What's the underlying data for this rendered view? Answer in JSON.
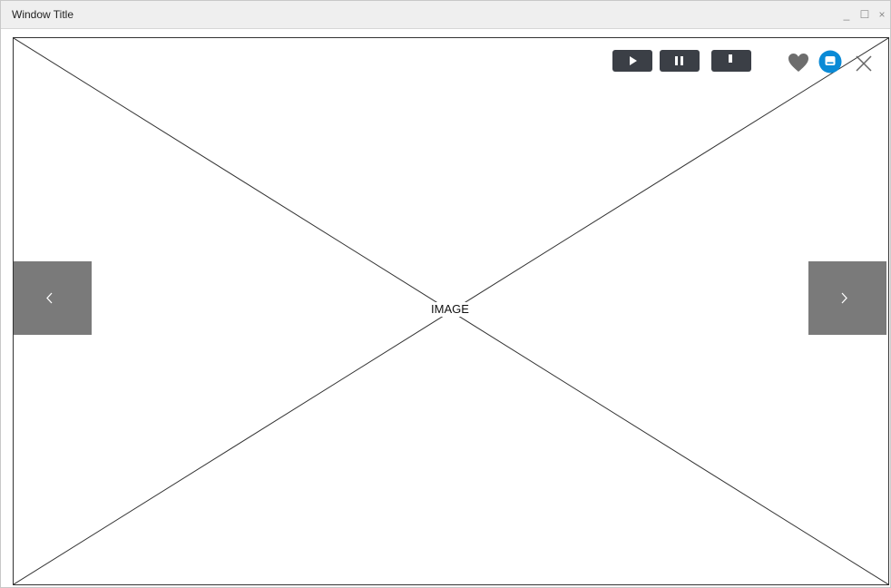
{
  "window": {
    "title": "Window Title",
    "controls": {
      "minimize": "_",
      "maximize": "☐",
      "close": "×"
    }
  },
  "viewer": {
    "placeholder_label": "IMAGE",
    "media_controls": [
      "play",
      "pause",
      "stop"
    ],
    "actions": [
      "favorite",
      "comment",
      "close"
    ],
    "navigation": [
      "previous",
      "next"
    ]
  },
  "colors": {
    "button_dark": "#3b3f46",
    "nav_gray": "#7a7a7a",
    "heart_gray": "#6d6d6d",
    "chat_blue": "#0a8ad6"
  }
}
